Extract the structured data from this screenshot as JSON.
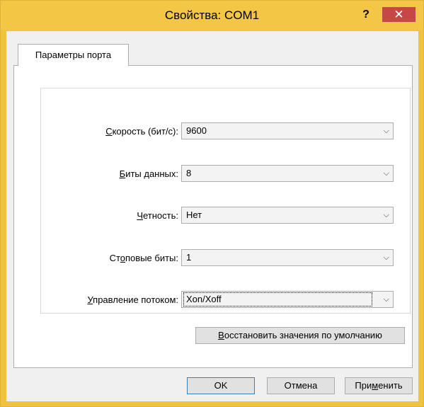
{
  "window": {
    "title": "Свойства: COM1",
    "help_label": "?",
    "close_label": "✕"
  },
  "tabs": [
    {
      "label": "Параметры порта",
      "selected": true
    }
  ],
  "fields": [
    {
      "label_underlined": "С",
      "label_rest": "корость (бит/с):",
      "value": "9600"
    },
    {
      "label_underlined": "Б",
      "label_rest": "иты данных:",
      "value": "8"
    },
    {
      "label_underlined": "Ч",
      "label_rest": "етность:",
      "value": "Нет"
    },
    {
      "label_prefix": "Ст",
      "label_underlined": "о",
      "label_rest": "повые биты:",
      "value": "1"
    },
    {
      "label_underlined": "У",
      "label_rest": "правление потоком:",
      "value": "Xon/Xoff"
    }
  ],
  "restore_button": {
    "underlined": "В",
    "rest": "осстановить значения по умолчанию"
  },
  "buttons": {
    "ok": "OK",
    "cancel": "Отмена",
    "apply_prefix": "При",
    "apply_underlined": "м",
    "apply_rest": "енить"
  },
  "colors": {
    "titlebar": "#f3c646",
    "close_button": "#c74646",
    "client_bg": "#f0f0f0"
  }
}
